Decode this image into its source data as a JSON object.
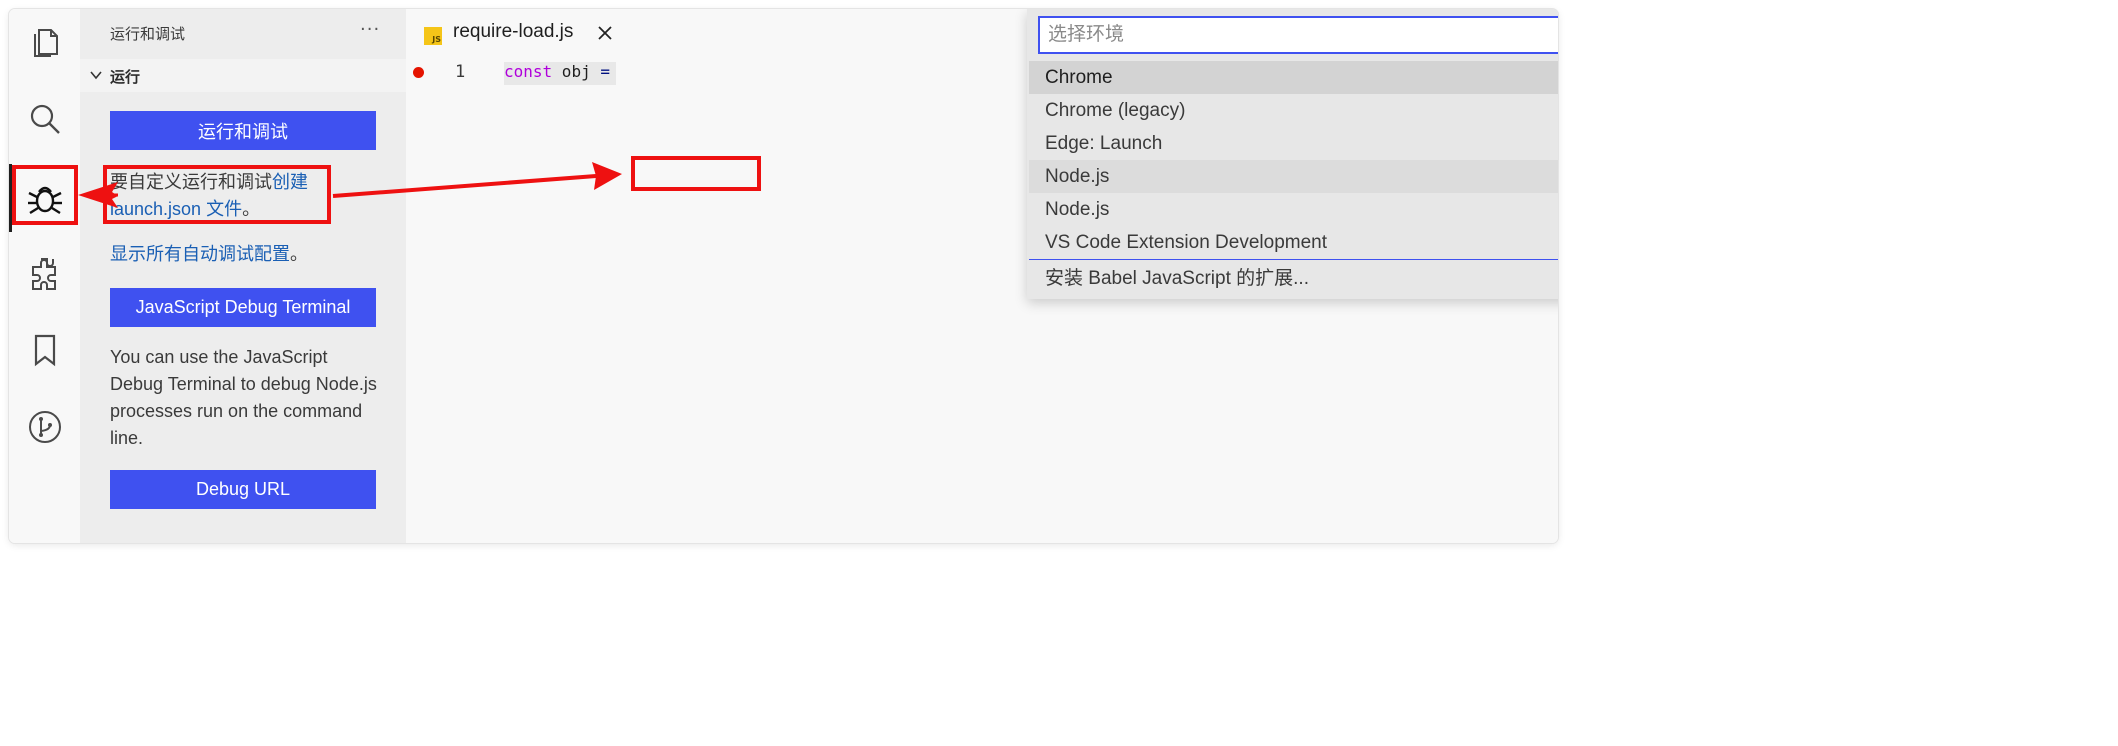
{
  "activity_bar": {
    "items": [
      {
        "icon": "files-icon"
      },
      {
        "icon": "search-icon"
      },
      {
        "icon": "debug-icon",
        "active": true
      },
      {
        "icon": "extensions-icon"
      },
      {
        "icon": "bookmark-icon"
      },
      {
        "icon": "git-icon"
      }
    ]
  },
  "sidebar": {
    "title": "运行和调试",
    "more": "···",
    "section_title": "运行",
    "run_debug_button": "运行和调试",
    "customize_text": "要自定义运行和调试",
    "create_link": "创建",
    "launch_json_link": "launch.json 文件",
    "customize_end": "。",
    "show_all_link": "显示所有自动调试配置",
    "show_all_end": "。",
    "js_terminal_button": "JavaScript Debug Terminal",
    "terminal_desc": "You can use the JavaScript Debug Terminal to debug Node.js processes run on the command line.",
    "debug_url_button": "Debug URL"
  },
  "editor": {
    "tab_name": "require-load.js",
    "js_badge": "JS",
    "line_number": "1",
    "code_keyword": "const",
    "code_rest": " obj ",
    "code_op": "="
  },
  "quick_pick": {
    "placeholder": "选择环境",
    "items": [
      {
        "label": "Chrome",
        "state": "selected"
      },
      {
        "label": "Chrome (legacy)",
        "state": ""
      },
      {
        "label": "Edge: Launch",
        "state": ""
      },
      {
        "label": "Node.js",
        "state": "hover"
      },
      {
        "label": "Node.js",
        "state": ""
      },
      {
        "label": "VS Code Extension Development",
        "state": ""
      }
    ],
    "install_item": "安装 Babel JavaScript 的扩展..."
  },
  "colors": {
    "accent": "#3f51f0",
    "annotation": "#ee1111",
    "breakpoint": "#e51400",
    "link": "#1a5fb4"
  }
}
